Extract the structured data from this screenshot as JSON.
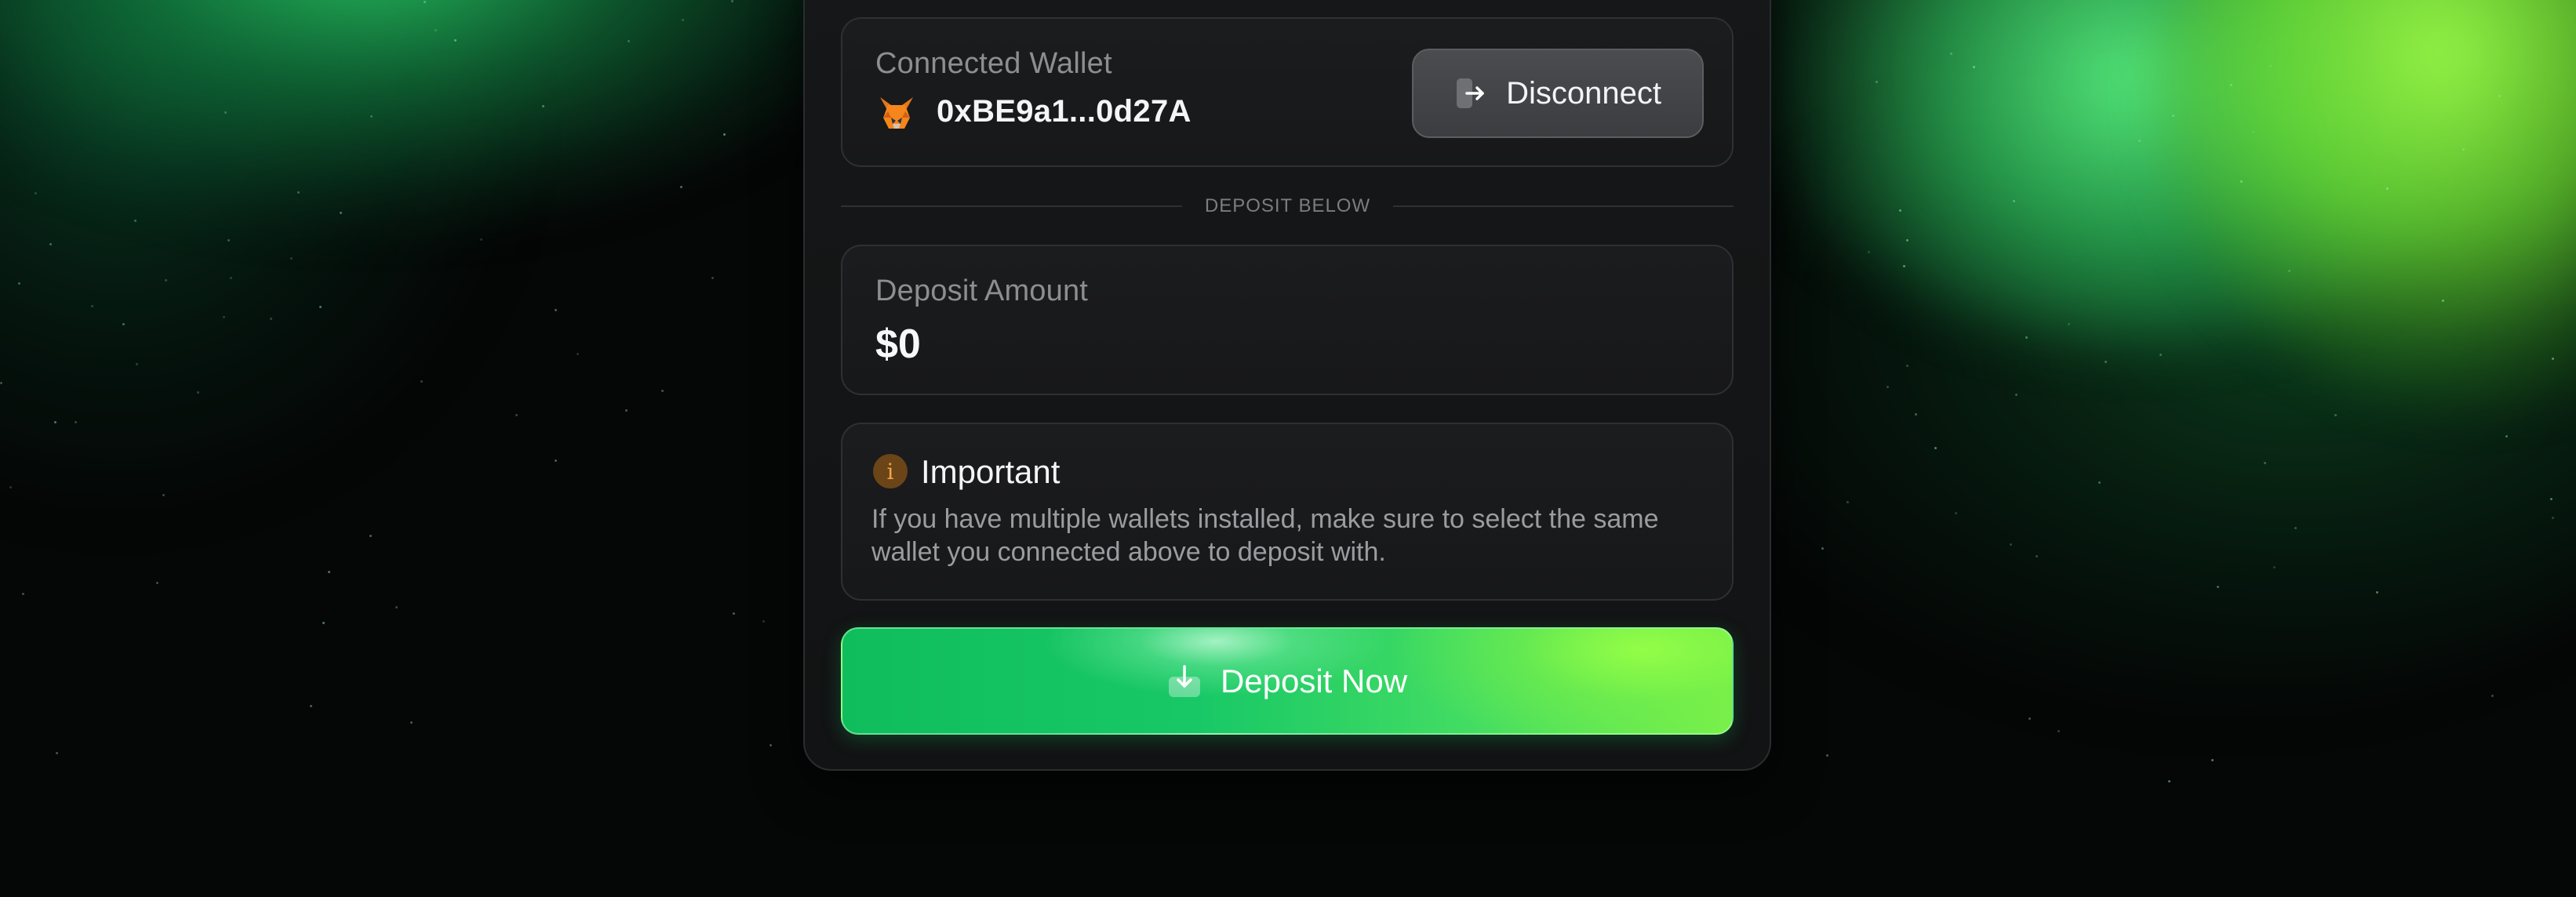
{
  "wallet": {
    "label": "Connected Wallet",
    "address": "0xBE9a1...0d27A",
    "disconnect_label": "Disconnect"
  },
  "divider": {
    "text": "DEPOSIT BELOW"
  },
  "amount": {
    "label": "Deposit Amount",
    "value": "$0"
  },
  "notice": {
    "title": "Important",
    "text": "If you have multiple wallets installed, make sure to select the same wallet you connected above to deposit with."
  },
  "deposit_button": {
    "label": "Deposit Now"
  },
  "icons": {
    "wallet": "metamask-fox-icon",
    "disconnect": "logout-arrow-icon",
    "notice": "info-icon",
    "deposit": "download-arrow-icon"
  },
  "colors": {
    "accent_green": "#18c866",
    "accent_lime": "#7af04a",
    "card_bg": "#151718",
    "notice_icon": "#f0a24c"
  }
}
